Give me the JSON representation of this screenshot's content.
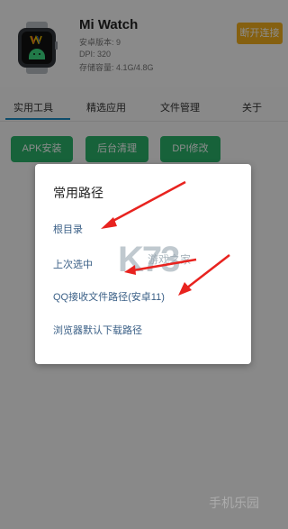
{
  "device": {
    "name": "Mi Watch",
    "android_version": "安卓版本: 9",
    "dpi": "DPI: 320",
    "storage": "存储容量: 4.1G/4.8G",
    "disconnect_label": "断开连接"
  },
  "tabs": [
    {
      "label": "实用工具",
      "active": true
    },
    {
      "label": "精选应用"
    },
    {
      "label": "文件管理"
    },
    {
      "label": "关于"
    }
  ],
  "tools": [
    {
      "label": "APK安装"
    },
    {
      "label": "后台清理"
    },
    {
      "label": "DPI修改"
    }
  ],
  "dialog": {
    "title": "常用路径",
    "paths": [
      {
        "label": "根目录"
      },
      {
        "label": "上次选中"
      },
      {
        "label": "QQ接收文件路径(安卓11)"
      },
      {
        "label": "浏览器默认下载路径"
      }
    ]
  },
  "watermarks": {
    "main": "K73",
    "main_sub": "游戏之家",
    "corner": "手机乐园"
  },
  "colors": {
    "accent_green": "#2ab36b",
    "disconnect_orange": "#f2b01e",
    "tab_underline": "#1b8ac4",
    "arrow_red": "#e8231f"
  }
}
